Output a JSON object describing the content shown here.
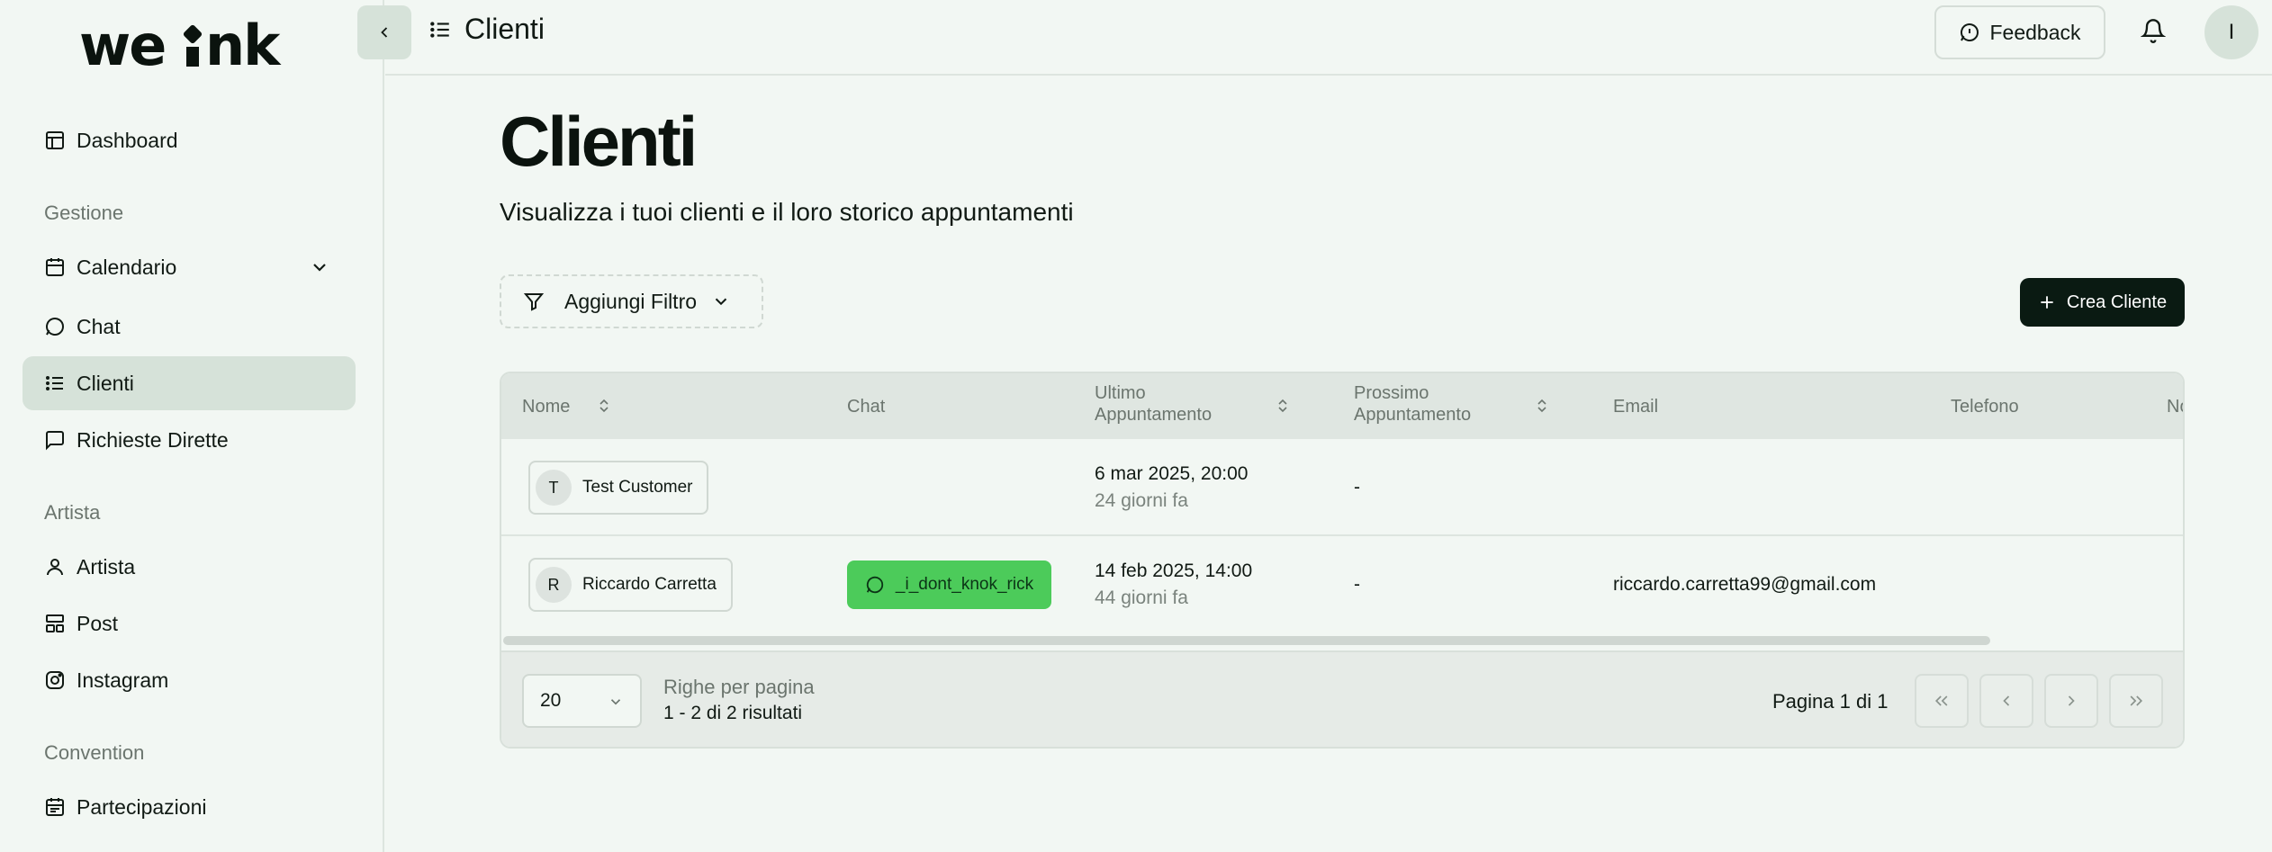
{
  "brand": {
    "logo_text": "weink"
  },
  "sidebar": {
    "items": [
      {
        "label": "Dashboard"
      },
      {
        "label": "Calendario"
      },
      {
        "label": "Chat"
      },
      {
        "label": "Clienti"
      },
      {
        "label": "Richieste Dirette"
      },
      {
        "label": "Artista"
      },
      {
        "label": "Post"
      },
      {
        "label": "Instagram"
      },
      {
        "label": "Partecipazioni"
      }
    ],
    "sections": [
      "Gestione",
      "Artista",
      "Convention"
    ],
    "active_item": "Clienti"
  },
  "topbar": {
    "title": "Clienti",
    "feedback_label": "Feedback",
    "avatar_initial": "I"
  },
  "main": {
    "title": "Clienti",
    "subtitle": "Visualizza i tuoi clienti e il loro storico appuntamenti",
    "filter_label": "Aggiungi Filtro",
    "create_label": "Crea Cliente"
  },
  "table": {
    "columns": [
      "Nome",
      "Chat",
      "Ultimo Appuntamento",
      "Prossimo Appuntamento",
      "Email",
      "Telefono",
      "No"
    ],
    "rows": [
      {
        "initial": "T",
        "name": "Test Customer",
        "chat": "",
        "last_date": "6 mar 2025, 20:00",
        "last_relative": "24 giorni fa",
        "next": "-",
        "email": "",
        "phone": ""
      },
      {
        "initial": "R",
        "name": "Riccardo Carretta",
        "chat": "_i_dont_knok_rick",
        "last_date": "14 feb 2025, 14:00",
        "last_relative": "44 giorni fa",
        "next": "-",
        "email": "riccardo.carretta99@gmail.com",
        "phone": ""
      }
    ]
  },
  "pagination": {
    "rows_per_page": "20",
    "rows_per_page_label": "Righe per pagina",
    "results": "1 - 2 di 2 risultati",
    "page_info": "Pagina 1 di 1"
  },
  "colors": {
    "background": "#f2f7f3",
    "active_nav": "#d6e2d9",
    "primary_button": "#0a1a12",
    "chat_chip": "#4ccb5a"
  }
}
